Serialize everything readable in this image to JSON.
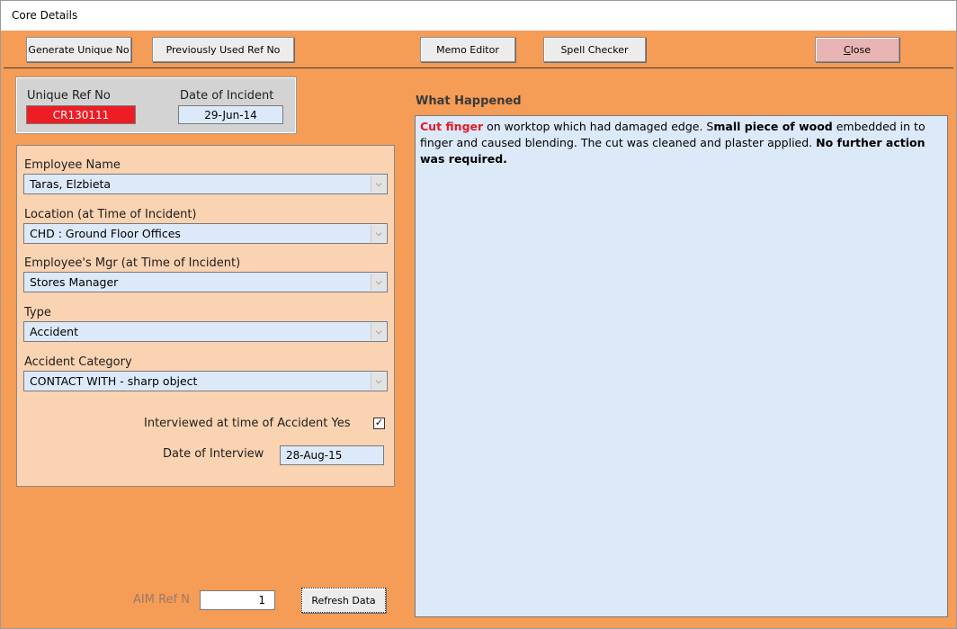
{
  "window": {
    "title": "Core Details"
  },
  "toolbar": {
    "generate_label": "Generate Unique No",
    "previous_ref_label": "Previously Used Ref No",
    "memo_editor_label": "Memo Editor",
    "spell_checker_label": "Spell Checker",
    "close_label": "Close",
    "close_mnemonic": "C",
    "close_rest": "lose"
  },
  "ref": {
    "unique_ref_label": "Unique Ref No",
    "unique_ref_value": "CR130111",
    "unique_ref_bg": "#ee1c24",
    "date_label": "Date of Incident",
    "date_value": "29-Jun-14"
  },
  "details": {
    "employee_name": {
      "label": "Employee Name",
      "value": "Taras, Elzbieta"
    },
    "location": {
      "label": "Location (at Time of Incident)",
      "value": "CHD : Ground Floor Offices"
    },
    "manager": {
      "label": "Employee's Mgr (at Time of Incident)",
      "value": "Stores Manager"
    },
    "type": {
      "label": "Type",
      "value": "Accident"
    },
    "category": {
      "label": "Accident Category",
      "value": "CONTACT WITH - sharp object"
    },
    "interviewed": {
      "label": "Interviewed at time of Accident Yes",
      "checked": true,
      "mark": "✓"
    },
    "interview_date": {
      "label": "Date of Interview",
      "value": "28-Aug-15"
    }
  },
  "what_happened": {
    "label": "What Happened",
    "parts": [
      {
        "text": "Cut finger",
        "style": "red-bold"
      },
      {
        "text": " on  worktop which had damaged edge.  S",
        "style": "normal"
      },
      {
        "text": "mall piece of wood",
        "style": "bold"
      },
      {
        "text": " embedded in to finger and caused blending.  The cut was cleaned and plaster applied.  ",
        "style": "normal"
      },
      {
        "text": "No further action was required",
        "style": "bold"
      },
      {
        "text": ".",
        "style": "normal"
      }
    ]
  },
  "footer": {
    "aim_label": "AIM Ref N",
    "aim_value": "1",
    "refresh_label": "Refresh Data"
  },
  "colors": {
    "form_bg": "#f59c56",
    "panel_bg": "#fad3b2",
    "field_bg": "#dce9f9",
    "accent_red": "#e11c24"
  }
}
